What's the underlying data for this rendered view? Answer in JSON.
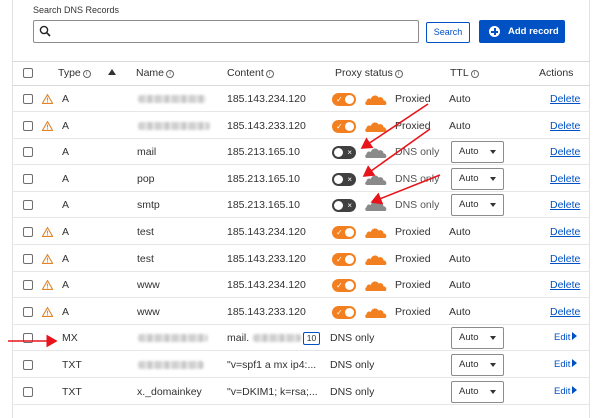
{
  "search": {
    "label": "Search DNS Records",
    "value": "",
    "search_button": "Search",
    "add_button": "Add record"
  },
  "columns": {
    "type": "Type",
    "name": "Name",
    "content": "Content",
    "proxy": "Proxy status",
    "ttl": "TTL",
    "actions": "Actions"
  },
  "rows": [
    {
      "warning": true,
      "type": "A",
      "name": "",
      "content": "185.143.234.120",
      "proxy_on": true,
      "proxy_label": "Proxied",
      "ttl": "Auto",
      "ttl_select": false,
      "action": "Delete"
    },
    {
      "warning": true,
      "type": "A",
      "name": "",
      "content": "185.143.233.120",
      "proxy_on": true,
      "proxy_label": "Proxied",
      "ttl": "Auto",
      "ttl_select": false,
      "action": "Delete"
    },
    {
      "warning": false,
      "type": "A",
      "name": "mail",
      "content": "185.213.165.10",
      "proxy_on": false,
      "proxy_label": "DNS only",
      "ttl": "Auto",
      "ttl_select": true,
      "action": "Delete"
    },
    {
      "warning": false,
      "type": "A",
      "name": "pop",
      "content": "185.213.165.10",
      "proxy_on": false,
      "proxy_label": "DNS only",
      "ttl": "Auto",
      "ttl_select": true,
      "action": "Delete"
    },
    {
      "warning": false,
      "type": "A",
      "name": "smtp",
      "content": "185.213.165.10",
      "proxy_on": false,
      "proxy_label": "DNS only",
      "ttl": "Auto",
      "ttl_select": true,
      "action": "Delete"
    },
    {
      "warning": true,
      "type": "A",
      "name": "test",
      "content": "185.143.234.120",
      "proxy_on": true,
      "proxy_label": "Proxied",
      "ttl": "Auto",
      "ttl_select": false,
      "action": "Delete"
    },
    {
      "warning": true,
      "type": "A",
      "name": "test",
      "content": "185.143.233.120",
      "proxy_on": true,
      "proxy_label": "Proxied",
      "ttl": "Auto",
      "ttl_select": false,
      "action": "Delete"
    },
    {
      "warning": true,
      "type": "A",
      "name": "www",
      "content": "185.143.234.120",
      "proxy_on": true,
      "proxy_label": "Proxied",
      "ttl": "Auto",
      "ttl_select": false,
      "action": "Delete"
    },
    {
      "warning": true,
      "type": "A",
      "name": "www",
      "content": "185.143.233.120",
      "proxy_on": true,
      "proxy_label": "Proxied",
      "ttl": "Auto",
      "ttl_select": false,
      "action": "Delete"
    },
    {
      "warning": false,
      "type": "MX",
      "name": "",
      "content": "mail.",
      "priority": "10",
      "proxy_label": "DNS only",
      "ttl": "Auto",
      "ttl_select": true,
      "action": "Edit"
    },
    {
      "warning": false,
      "type": "TXT",
      "name": "",
      "content": "\"v=spf1 a mx ip4:...",
      "proxy_label": "DNS only",
      "ttl": "Auto",
      "ttl_select": true,
      "action": "Edit"
    },
    {
      "warning": false,
      "type": "TXT",
      "name": "x._domainkey",
      "content": "\"v=DKIM1; k=rsa;...",
      "proxy_label": "DNS only",
      "ttl": "Auto",
      "ttl_select": true,
      "action": "Edit"
    }
  ],
  "colors": {
    "accent": "#0051c3",
    "proxy_orange": "#f38020",
    "arrow_red": "#e8141b"
  }
}
